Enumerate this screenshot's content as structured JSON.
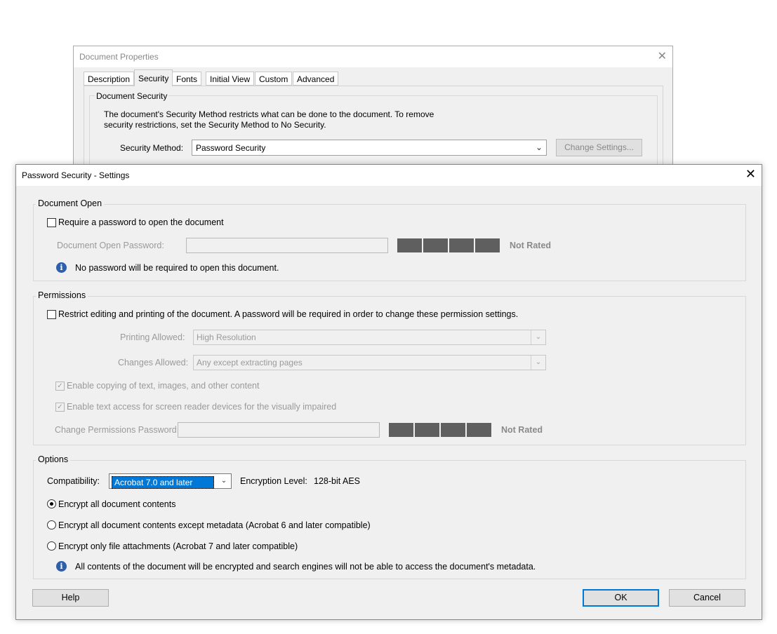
{
  "background_dialog": {
    "title": "Document Properties",
    "close_glyph": "✕",
    "tabs": [
      {
        "label": "Description",
        "active": false
      },
      {
        "label": "Security",
        "active": true
      },
      {
        "label": "Fonts",
        "active": false
      },
      {
        "label": "Initial View",
        "active": false
      },
      {
        "label": "Custom",
        "active": false
      },
      {
        "label": "Advanced",
        "active": false
      }
    ],
    "group_title": "Document Security",
    "description_line1": "The document's Security Method restricts what can be done to the document. To remove",
    "description_line2": "security restrictions, set the Security Method to No Security.",
    "security_method_label": "Security Method:",
    "security_method_value": "Password Security",
    "change_settings_label": "Change Settings..."
  },
  "dialog": {
    "title": "Password Security - Settings",
    "close_glyph": "✕",
    "document_open": {
      "group_title": "Document Open",
      "require_password_label": "Require a password to open the document",
      "require_password_checked": false,
      "password_field_label": "Document Open Password:",
      "password_value": "",
      "rating_label": "Not Rated",
      "info_text": "No password will be required to open this document."
    },
    "permissions": {
      "group_title": "Permissions",
      "restrict_label": "Restrict editing and printing of the document. A password will be required in order to change these permission settings.",
      "restrict_checked": false,
      "printing_label": "Printing Allowed:",
      "printing_value": "High Resolution",
      "changes_label": "Changes Allowed:",
      "changes_value": "Any except extracting pages",
      "copy_label": "Enable copying of text, images, and other content",
      "copy_checked": true,
      "screen_reader_label": "Enable text access for screen reader devices for the visually impaired",
      "screen_reader_checked": true,
      "change_password_label": "Change Permissions Password:",
      "change_password_value": "",
      "rating_label": "Not Rated"
    },
    "options": {
      "group_title": "Options",
      "compatibility_label": "Compatibility:",
      "compatibility_value": "Acrobat 7.0 and later",
      "encryption_label": "Encryption  Level:",
      "encryption_value": "128-bit AES",
      "radios": [
        {
          "label": "Encrypt all document contents",
          "selected": true
        },
        {
          "label": "Encrypt all document contents except metadata (Acrobat 6 and later compatible)",
          "selected": false
        },
        {
          "label": "Encrypt only file attachments (Acrobat 7 and later compatible)",
          "selected": false
        }
      ],
      "info_text": "All contents of the document will be encrypted and search engines will not be able to access the document's metadata."
    },
    "buttons": {
      "help": "Help",
      "ok": "OK",
      "cancel": "Cancel"
    }
  },
  "icons": {
    "info": "i",
    "dropdown": "⌄",
    "check": "✓"
  },
  "colors": {
    "accent": "#0078d7",
    "dialog_bg": "#f0f0f0",
    "meter": "#5f5f5f",
    "info_icon": "#2f5fa8"
  }
}
